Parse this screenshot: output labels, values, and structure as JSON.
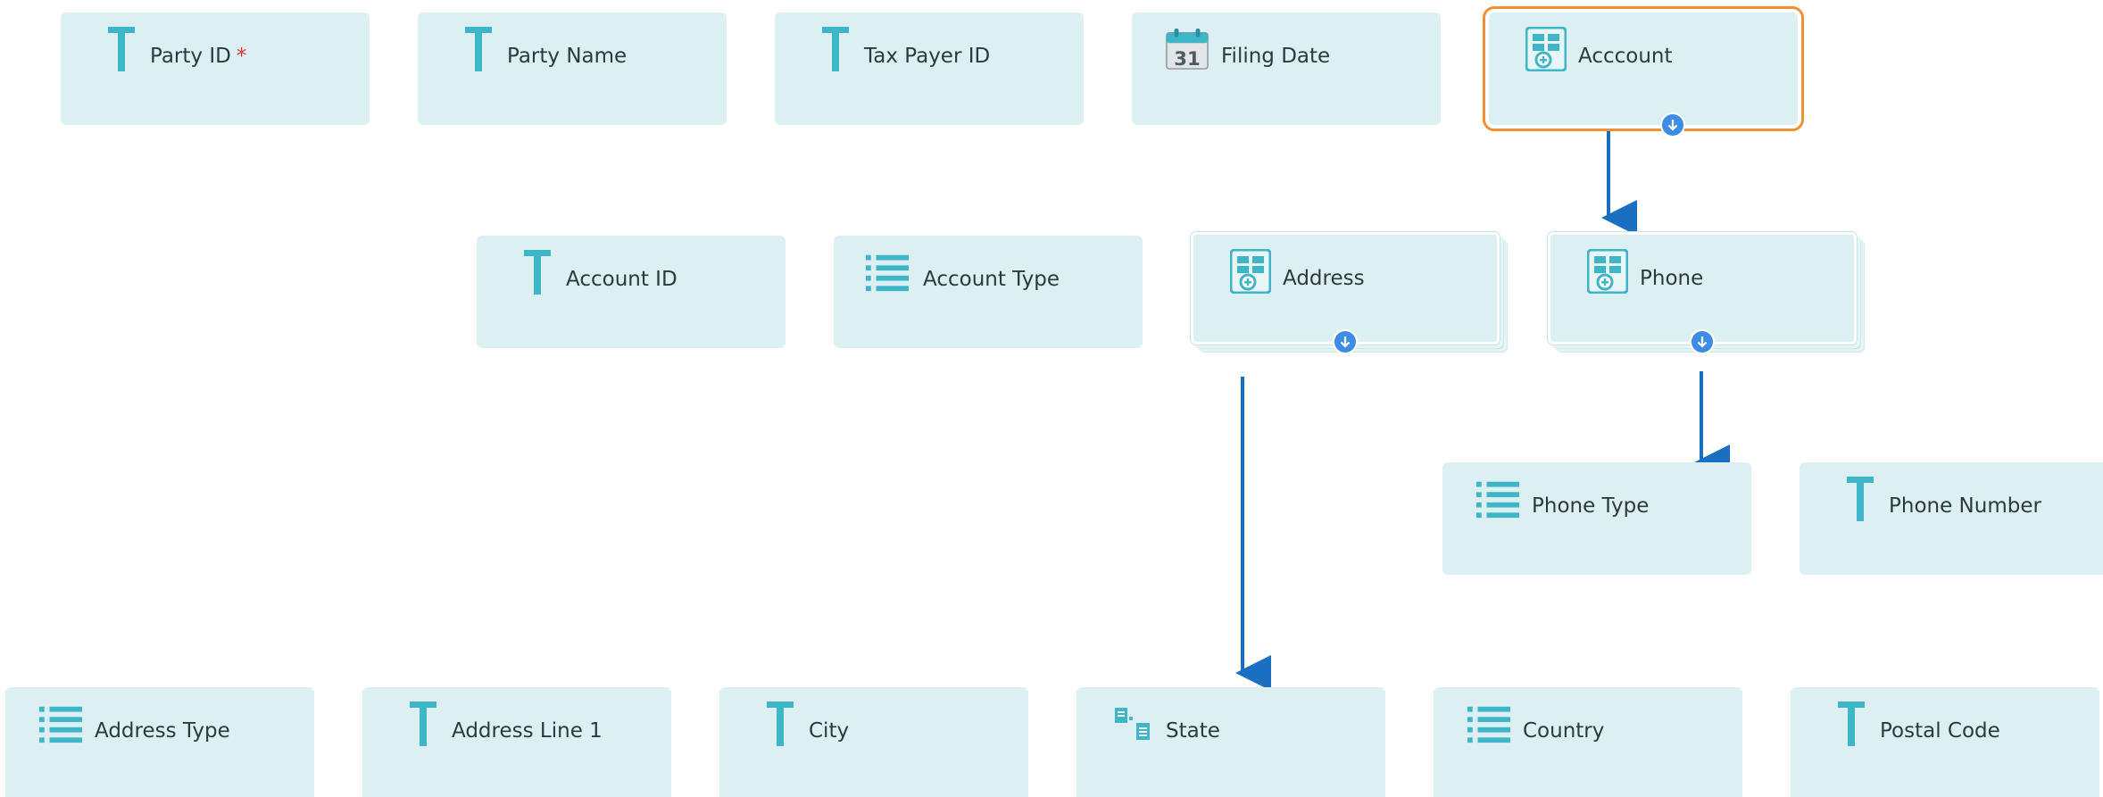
{
  "row1": {
    "party_id": {
      "label": "Party ID",
      "required_mark": "*"
    },
    "party_name": {
      "label": "Party Name"
    },
    "tax_payer_id": {
      "label": "Tax Payer ID"
    },
    "filing_date": {
      "label": "Filing Date",
      "calendar_day": "31"
    },
    "account": {
      "label": "Acccount"
    }
  },
  "row2": {
    "account_id": {
      "label": "Account ID"
    },
    "account_type": {
      "label": "Account Type"
    },
    "address": {
      "label": "Address"
    },
    "phone": {
      "label": "Phone"
    }
  },
  "row3": {
    "phone_type": {
      "label": "Phone Type"
    },
    "phone_number": {
      "label": "Phone Number"
    }
  },
  "row4": {
    "address_type": {
      "label": "Address Type"
    },
    "address_line_1": {
      "label": "Address Line 1"
    },
    "city": {
      "label": "City"
    },
    "state": {
      "label": "State"
    },
    "country": {
      "label": "Country"
    },
    "postal_code": {
      "label": "Postal Code"
    }
  },
  "icons": {
    "text_field": "text-field-icon",
    "date_field": "calendar-icon",
    "list_field": "list-icon",
    "group": "field-group-icon",
    "lookup": "lookup-icon",
    "expand": "expand-down-icon"
  },
  "colors": {
    "card_bg": "#dcf0f3",
    "icon_teal": "#3fb6c8",
    "arrow": "#1b6fc0",
    "expand_badge": "#3d8de5",
    "selected_outline": "#f0912f",
    "required": "#e0352b"
  }
}
